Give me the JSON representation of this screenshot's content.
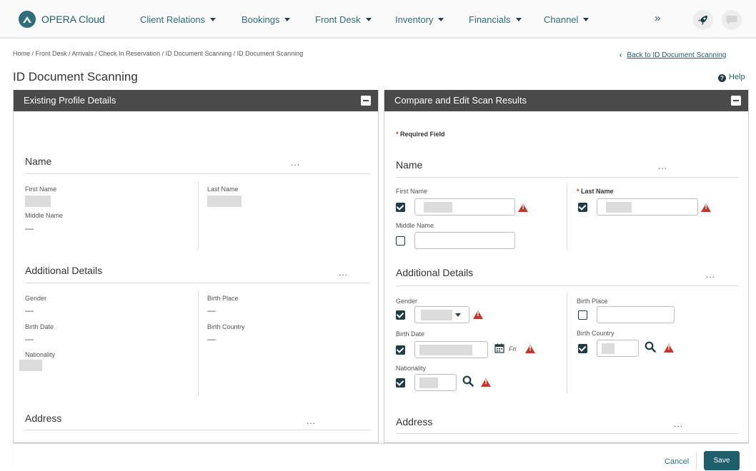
{
  "app": {
    "title": "OPERA Cloud"
  },
  "nav": {
    "items": [
      {
        "label": "Client Relations"
      },
      {
        "label": "Bookings"
      },
      {
        "label": "Front Desk"
      },
      {
        "label": "Inventory"
      },
      {
        "label": "Financials"
      },
      {
        "label": "Channel"
      }
    ],
    "more": "»"
  },
  "breadcrumb": "Home / Front Desk / Arrivals / Check In Reservation / ID Document Scanning / ID Document Scanning",
  "back_link": "Back to ID Document Scanning",
  "page_title": "ID Document Scanning",
  "help": "Help",
  "left": {
    "title": "Existing Profile Details",
    "name": {
      "title": "Name",
      "more": "...",
      "first_name_label": "First Name",
      "middle_name_label": "Middle Name",
      "middle_name_value": "—",
      "last_name_label": "Last Name"
    },
    "additional": {
      "title": "Additional Details",
      "more": "...",
      "gender_label": "Gender",
      "gender_value": "—",
      "birth_date_label": "Birth Date",
      "birth_date_value": "—",
      "nationality_label": "Nationality",
      "birth_place_label": "Birth Place",
      "birth_place_value": "—",
      "birth_country_label": "Birth Country",
      "birth_country_value": "—"
    },
    "address": {
      "title": "Address",
      "more": "..."
    }
  },
  "right": {
    "title": "Compare and Edit Scan Results",
    "required_star": "*",
    "required_label": "Required Field",
    "name": {
      "title": "Name",
      "more": "...",
      "first_name_label": "First Name",
      "middle_name_label": "Middle Name",
      "last_name_label": "Last Name"
    },
    "additional": {
      "title": "Additional Details",
      "more": "...",
      "gender_label": "Gender",
      "birth_date_label": "Birth Date",
      "day": "Fri",
      "nationality_label": "Nationality",
      "birth_place_label": "Birth Place",
      "birth_country_label": "Birth Country"
    },
    "address": {
      "title": "Address",
      "more": "..."
    }
  },
  "footer": {
    "cancel": "Cancel",
    "save": "Save"
  },
  "colors": {
    "brand": "#1f5f6b",
    "header_dark": "#4a4a4a",
    "warning": "#c0392b"
  }
}
